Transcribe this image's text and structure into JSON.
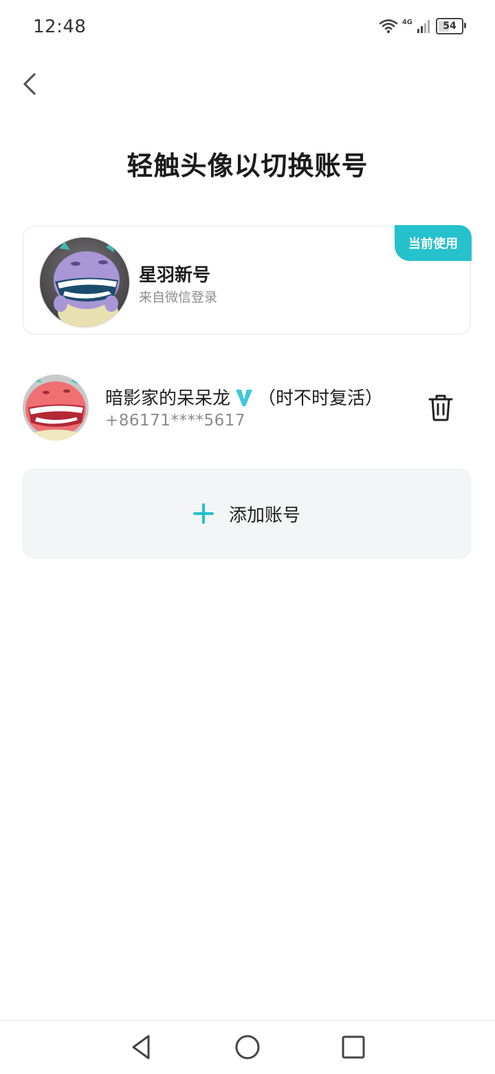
{
  "status_bar": {
    "time": "12:48",
    "network": "4G",
    "battery": "54",
    "battery_level": 0.54,
    "icons": [
      "wifi-icon",
      "cellular-signal-icon",
      "battery-icon"
    ]
  },
  "header": {
    "back_icon": "chevron-left-icon"
  },
  "title": "轻触头像以切换账号",
  "current_account": {
    "badge": "当前使用",
    "name": "星羽新号",
    "subtitle": "来自微信登录"
  },
  "accounts": [
    {
      "name": "暗影家的呆呆龙",
      "suffix": "（时不时复活）",
      "phone": "+86171****5617",
      "delete_icon": "trash-icon",
      "verified_icon": "verified-v-icon"
    }
  ],
  "add_account": {
    "label": "添加账号",
    "icon": "plus-icon"
  },
  "nav": {
    "icons": [
      "back-triangle-icon",
      "home-circle-icon",
      "recents-square-icon"
    ]
  },
  "colors": {
    "accent": "#25c1cc",
    "verified": "#3ec6e0",
    "card_border": "#e3e6ea",
    "add_bg": "#f4f5f7"
  }
}
